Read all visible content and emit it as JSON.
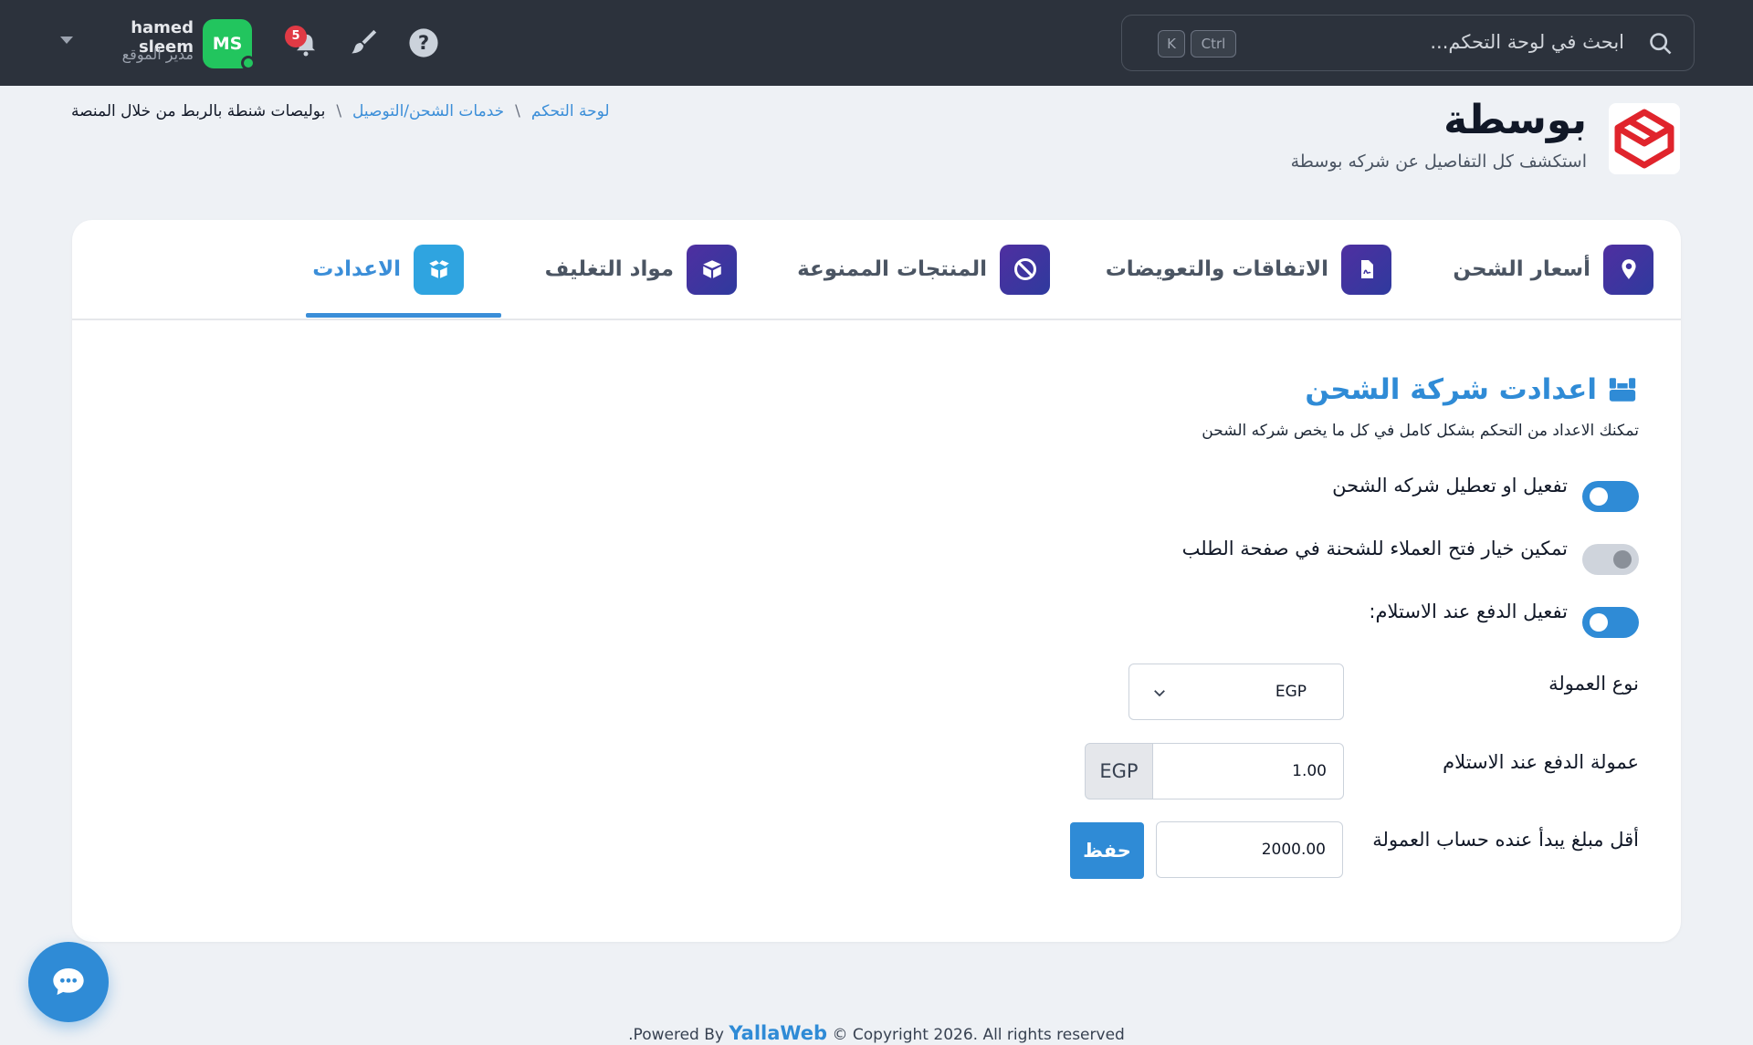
{
  "topbar": {
    "search_placeholder": "ابحث في لوحة التحكم...",
    "shortcut_ctrl": "Ctrl",
    "shortcut_key": "K",
    "notification_count": "5",
    "user_name": "hamed sleem",
    "user_role": "مدير الموقع",
    "avatar_initials": "MS"
  },
  "header": {
    "title": "بوسطة",
    "subtitle": "استكشف كل التفاصيل عن شركه بوسطة"
  },
  "breadcrumb": {
    "home": "لوحة التحكم",
    "section": "خدمات الشحن/التوصيل",
    "current": "بوليصات شنطة بالربط من خلال المنصة",
    "separator": "\\"
  },
  "tabs": [
    {
      "label": "أسعار الشحن",
      "icon": "map-pin-icon"
    },
    {
      "label": "الاتفاقات والتعويضات",
      "icon": "document-icon"
    },
    {
      "label": "المنتجات الممنوعة",
      "icon": "ban-icon"
    },
    {
      "label": "مواد التغليف",
      "icon": "box-icon"
    },
    {
      "label": "الاعدادت",
      "icon": "box-open-icon",
      "active": true
    }
  ],
  "settings": {
    "title": "اعدادت شركة الشحن",
    "description": "تمكنك الاعداد من التحكم بشكل كامل في كل ما يخص شركه الشحن",
    "toggles": [
      {
        "label": "تفعيل او تعطيل شركه الشحن",
        "on": true
      },
      {
        "label": "تمكين خيار فتح العملاء للشحنة في صفحة الطلب",
        "on": false
      },
      {
        "label": "تفعيل الدفع عند الاستلام:",
        "on": true
      }
    ],
    "commission_type_label": "نوع العمولة",
    "commission_type_value": "EGP",
    "cod_commission_label": "عمولة الدفع عند الاستلام",
    "cod_commission_value": "1.00",
    "cod_commission_unit": "EGP",
    "min_amount_label": "أقل مبلغ يبدأ عنده حساب العمولة",
    "min_amount_value": "2000.00",
    "save_label": "حفظ"
  },
  "footer": {
    "copyright": "© Copyright 2026. All rights reserved",
    "brand": "YallaWeb",
    "powered_by": ".Powered By"
  },
  "colors": {
    "accent": "#2f8bd6",
    "topbar": "#2c323c",
    "brand_red": "#e0242c"
  }
}
